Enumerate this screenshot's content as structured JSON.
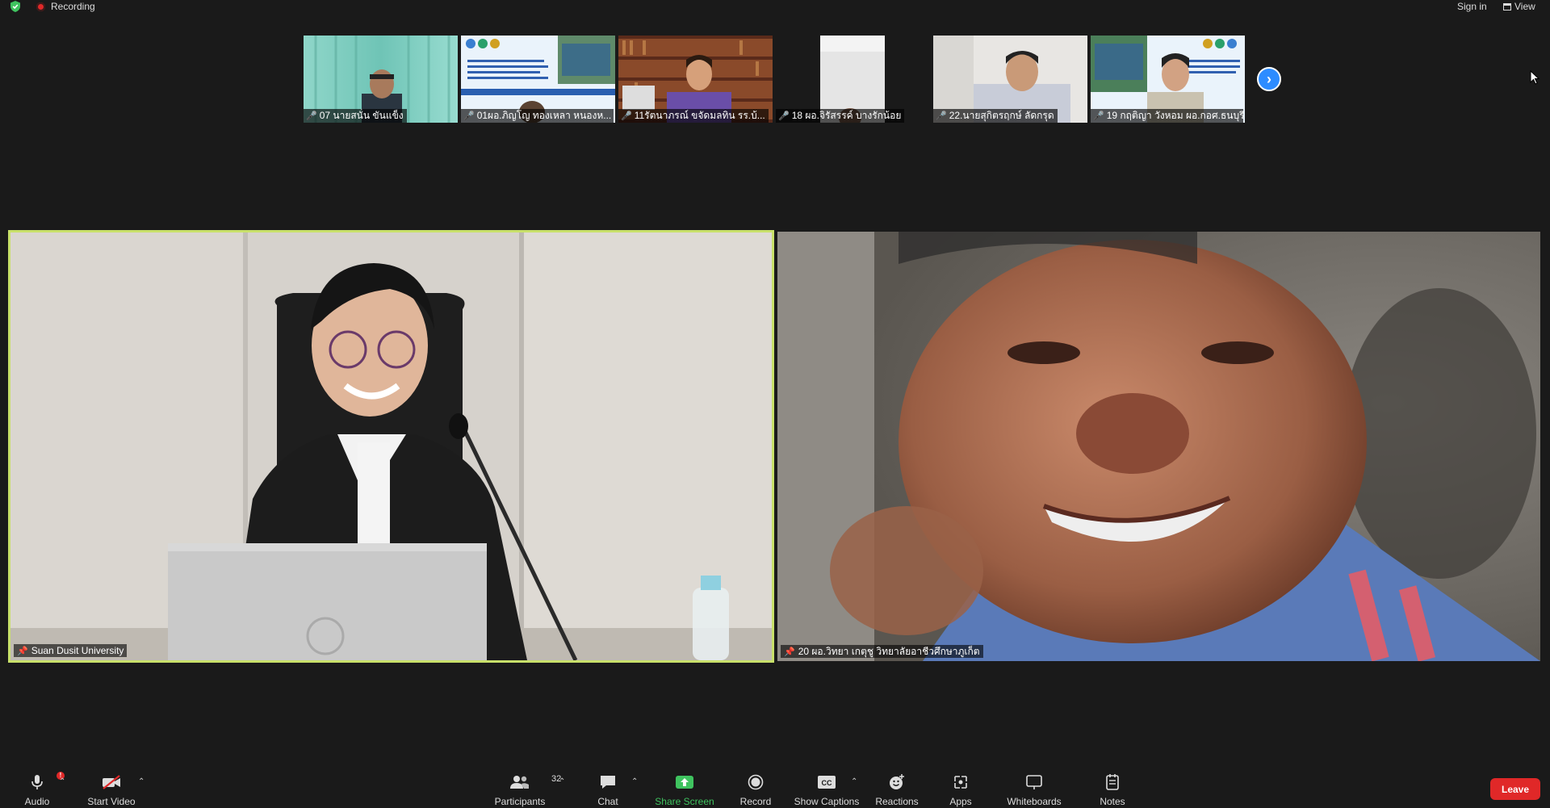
{
  "topbar": {
    "recording_label": "Recording",
    "signin_label": "Sign in",
    "view_label": "View"
  },
  "thumbnails": [
    {
      "name": "07 นายสนั่น ขันแข็ง"
    },
    {
      "name": "01ผอ.ภิญโญ  ทองเหลา หนองห..."
    },
    {
      "name": "11รัตนาภรณ์  ขจัดมลทิน รร.บ้..."
    },
    {
      "name": "18 ผอ.จิรัสรรค์ บางรักน้อย"
    },
    {
      "name": "22.นายสุกิตรฤกษ์ ลัดกรุด"
    },
    {
      "name": "19 กฤติญา วังหอม ผอ.กอศ.ธนบุรี"
    }
  ],
  "main": {
    "left_name": "Suan Dusit University",
    "right_name": "20 ผอ.วิทยา เกตุชู วิทยาลัยอาชีวศึกษาภูเก็ต"
  },
  "toolbar": {
    "audio": "Audio",
    "start_video": "Start Video",
    "participants": "Participants",
    "participants_count": "32",
    "chat": "Chat",
    "share_screen": "Share Screen",
    "record": "Record",
    "show_captions": "Show Captions",
    "reactions": "Reactions",
    "apps": "Apps",
    "whiteboards": "Whiteboards",
    "notes": "Notes",
    "leave": "Leave",
    "audio_badge": "!"
  },
  "colors": {
    "accent_blue": "#2d8cff",
    "share_green": "#3fc35f",
    "leave_red": "#e02828",
    "speaker_border": "#c8e06a"
  }
}
